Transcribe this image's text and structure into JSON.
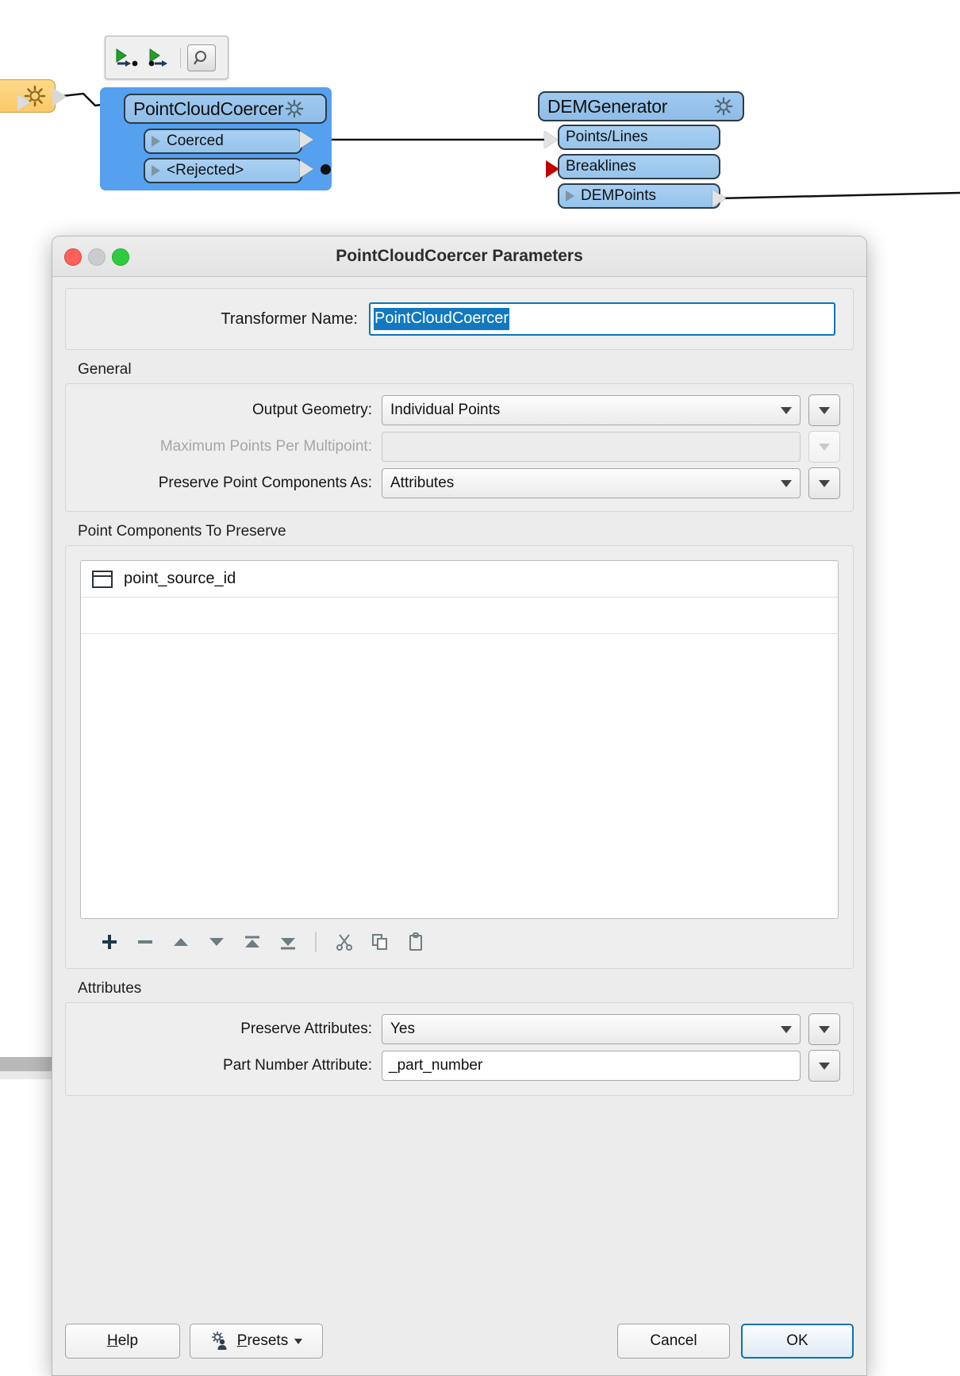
{
  "canvas": {
    "mini_toolbar": {
      "buttons": [
        {
          "name": "run-to-this-icon",
          "label": "▶"
        },
        {
          "name": "run-from-this-icon",
          "label": "▶"
        },
        {
          "name": "inspect-magnifier-icon",
          "label": "⚲"
        }
      ]
    },
    "feeder_node": {
      "icon": "gear-icon"
    },
    "transformer": {
      "title": "PointCloudCoercer",
      "gear_icon": "gear-icon",
      "ports": [
        {
          "label": "Coerced"
        },
        {
          "label": "<Rejected>"
        }
      ]
    },
    "dem_generator": {
      "title": "DEMGenerator",
      "gear_icon": "gear-icon",
      "ports": [
        {
          "label": "Points/Lines"
        },
        {
          "label": "Breaklines"
        },
        {
          "label": "DEMPoints"
        }
      ]
    }
  },
  "dialog": {
    "title": "PointCloudCoercer Parameters",
    "window_controls": {
      "close": "close-button",
      "minimize": "minimize-button",
      "zoom": "zoom-button"
    },
    "transformer_name": {
      "label": "Transformer Name:",
      "value": "PointCloudCoercer",
      "selected": true
    },
    "general": {
      "heading": "General",
      "rows": [
        {
          "label": "Output Geometry:",
          "value": "Individual Points",
          "type": "combo",
          "disabled": false
        },
        {
          "label": "Maximum Points Per Multipoint:",
          "value": "",
          "type": "text",
          "disabled": true
        },
        {
          "label": "Preserve Point Components As:",
          "value": "Attributes",
          "type": "combo",
          "disabled": false
        }
      ]
    },
    "point_components": {
      "heading": "Point Components To Preserve",
      "items": [
        {
          "icon": "column-icon",
          "label": "point_source_id"
        }
      ],
      "toolbar": [
        {
          "name": "add-button",
          "glyph": "＋"
        },
        {
          "name": "remove-button",
          "glyph": "−"
        },
        {
          "name": "move-up-button",
          "glyph": "▲"
        },
        {
          "name": "move-down-button",
          "glyph": "▼"
        },
        {
          "name": "move-to-top-button",
          "glyph": "⤒"
        },
        {
          "name": "move-to-bottom-button",
          "glyph": "⤓"
        },
        {
          "name": "cut-button",
          "glyph": "✂"
        },
        {
          "name": "copy-button",
          "glyph": "⧉"
        },
        {
          "name": "paste-button",
          "glyph": "ὌB"
        }
      ]
    },
    "attributes": {
      "heading": "Attributes",
      "rows": [
        {
          "label": "Preserve Attributes:",
          "value": "Yes",
          "type": "combo",
          "disabled": false
        },
        {
          "label": "Part Number Attribute:",
          "value": "_part_number",
          "type": "text",
          "disabled": false
        }
      ]
    },
    "footer": {
      "help": "Help",
      "help_mnemonic": "H",
      "presets": "Presets",
      "presets_mnemonic": "P",
      "cancel": "Cancel",
      "ok": "OK"
    }
  },
  "colors": {
    "accent_blue": "#0a72b6",
    "selection_blue": "#1279c0",
    "node_blue": "#56a0f0",
    "node_header_blue": "#9fc9ef",
    "feeder_yellow": "#ffd98a",
    "breakline_red": "#c00000",
    "dialog_bg": "#ececec"
  }
}
